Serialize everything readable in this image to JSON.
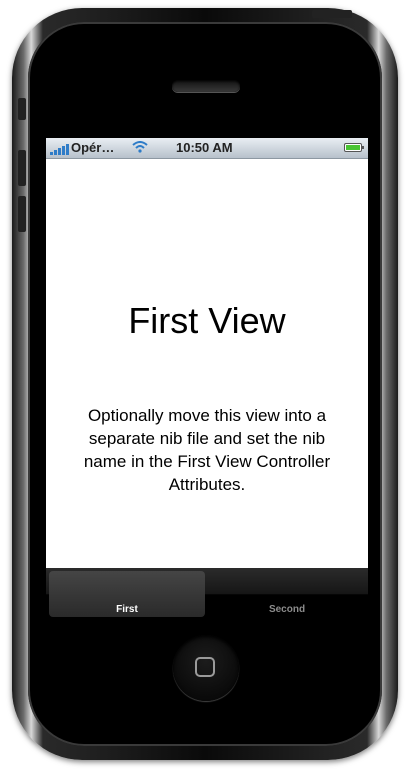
{
  "status_bar": {
    "carrier": "Opér…",
    "time": "10:50 AM",
    "signal_bars": 5,
    "battery_level": 1.0,
    "colors": {
      "signal": "#2e7cc8",
      "battery": "#49c433"
    }
  },
  "view": {
    "title": "First View",
    "description": "Optionally move this view into a separate nib file and set the nib name in the First View Controller Attributes."
  },
  "tab_bar": {
    "tabs": [
      {
        "label": "First",
        "selected": true
      },
      {
        "label": "Second",
        "selected": false
      }
    ]
  },
  "icons": [
    "signal-icon",
    "wifi-icon",
    "battery-icon",
    "home-button-icon"
  ]
}
